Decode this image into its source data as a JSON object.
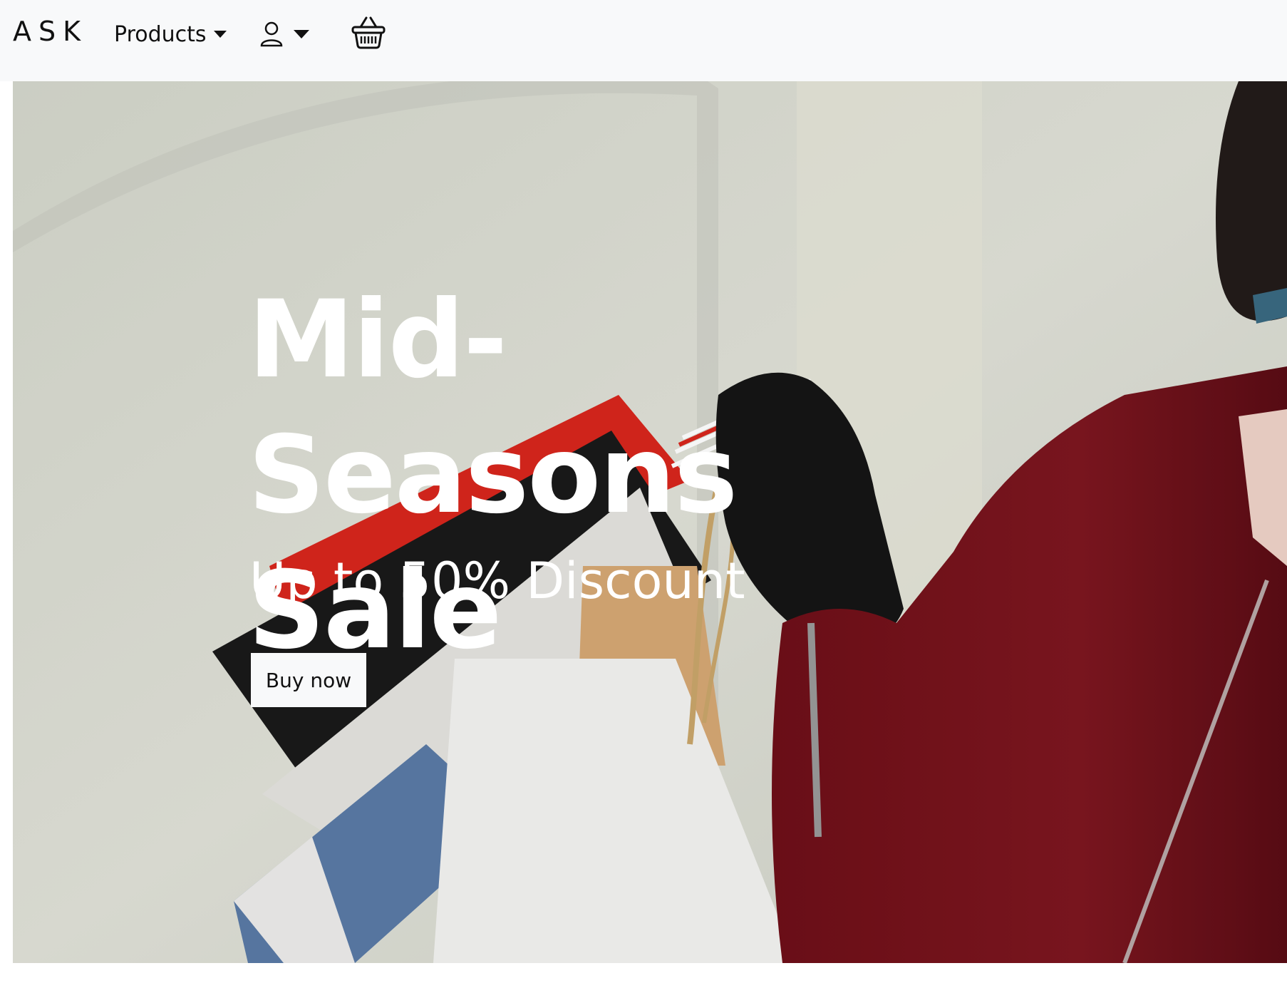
{
  "navbar": {
    "brand": "ASK",
    "products_label": "Products",
    "user_icon": "user-icon",
    "basket_icon": "basket-icon",
    "background": "#f8f9fa"
  },
  "hero": {
    "title": "Mid-Seasons Sale",
    "subtitle": "Up to 50% Discount",
    "button_label": "Buy now",
    "image_description": "shopping-bags-photo"
  }
}
